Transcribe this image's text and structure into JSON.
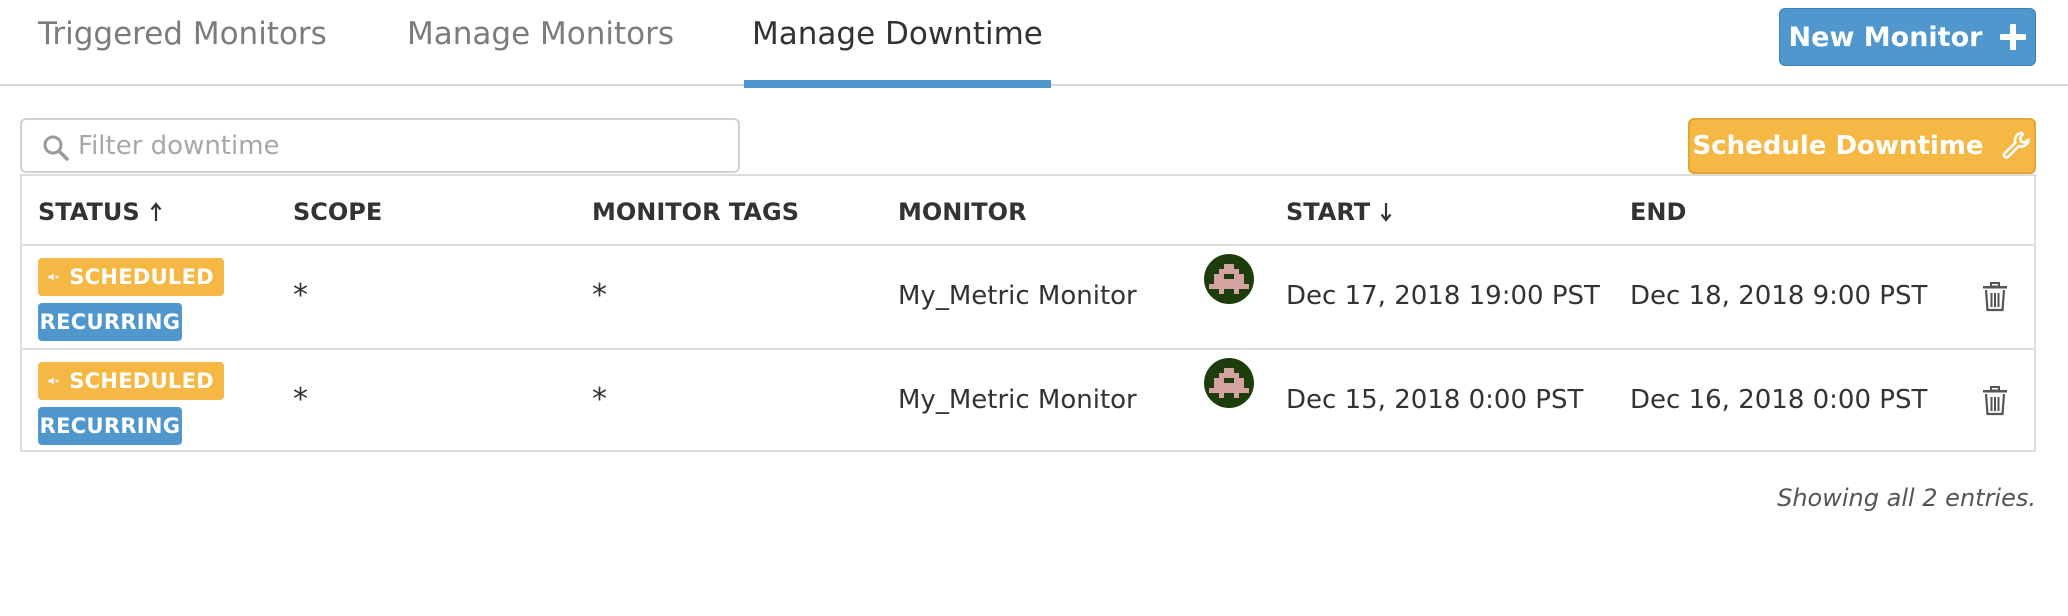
{
  "tabs": [
    {
      "label": "Triggered Monitors",
      "active": false
    },
    {
      "label": "Manage Monitors",
      "active": false
    },
    {
      "label": "Manage Downtime",
      "active": true
    }
  ],
  "new_monitor_button": {
    "label": "New Monitor",
    "icon": "plus-icon"
  },
  "schedule_downtime_button": {
    "label": "Schedule Downtime",
    "icon": "wrench-icon"
  },
  "search": {
    "placeholder": "Filter downtime",
    "value": "",
    "icon": "search-icon"
  },
  "table": {
    "columns": [
      {
        "label": "STATUS",
        "sort": "asc",
        "sort_icon": "arrow-up-icon"
      },
      {
        "label": "SCOPE"
      },
      {
        "label": "MONITOR TAGS"
      },
      {
        "label": "MONITOR"
      },
      {
        "label": "START",
        "sort": "desc",
        "sort_icon": "arrow-down-icon"
      },
      {
        "label": "END"
      }
    ],
    "rows": [
      {
        "status": "SCHEDULED",
        "status_icon": "mute-icon",
        "recurring": "RECURRING",
        "scope": "*",
        "monitor_tags": "*",
        "monitor": "My_Metric Monitor",
        "start": "Dec 17, 2018 19:00 PST",
        "end": "Dec 18, 2018 9:00 PST"
      },
      {
        "status": "SCHEDULED",
        "status_icon": "mute-icon",
        "recurring": "RECURRING",
        "scope": "*",
        "monitor_tags": "*",
        "monitor": "My_Metric Monitor",
        "start": "Dec 15, 2018 0:00 PST",
        "end": "Dec 16, 2018 0:00 PST"
      }
    ]
  },
  "footer": {
    "text": "Showing all 2 entries."
  },
  "colors": {
    "accent_blue": "#4f97cc",
    "accent_orange": "#f6b845",
    "avatar_bg": "#1e3d0c",
    "avatar_fg": "#d4a2a0"
  }
}
